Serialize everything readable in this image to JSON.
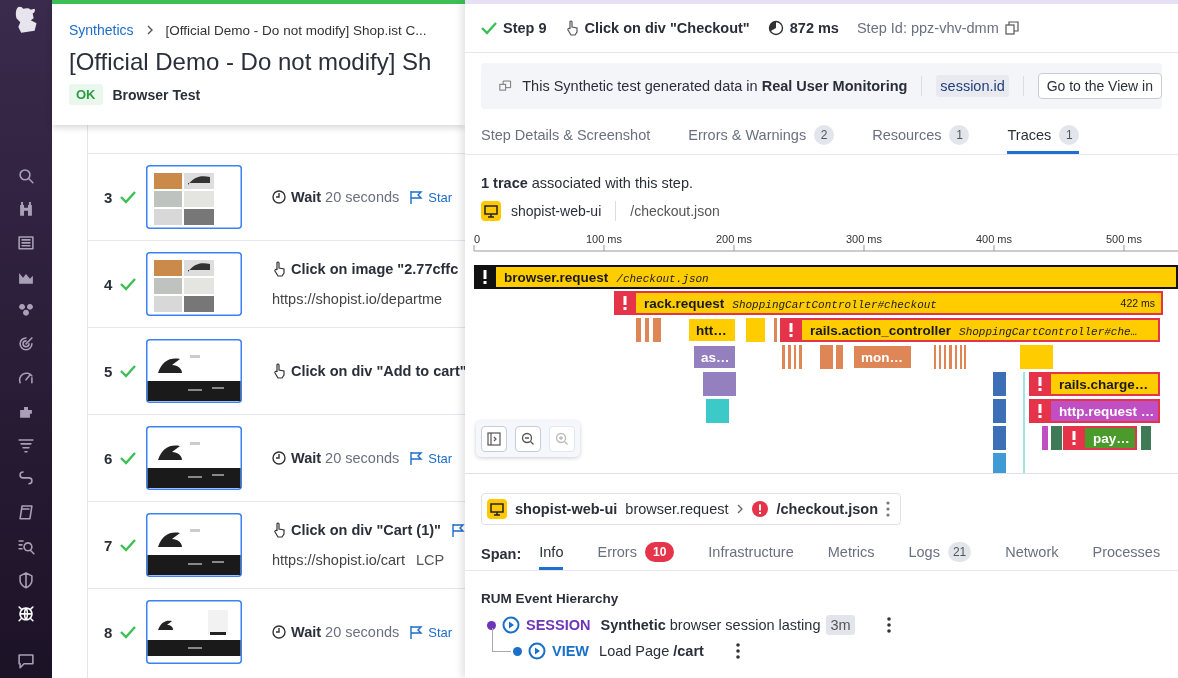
{
  "sidebar": {
    "items": [
      {
        "selected": false
      },
      {
        "selected": false
      },
      {
        "selected": false
      },
      {
        "selected": false
      },
      {
        "selected": false
      },
      {
        "selected": false
      },
      {
        "selected": false
      },
      {
        "selected": false
      },
      {
        "selected": false
      },
      {
        "selected": false
      },
      {
        "selected": false
      },
      {
        "selected": false
      },
      {
        "selected": false
      },
      {
        "selected": true
      },
      {
        "selected": false
      }
    ]
  },
  "test_header": {
    "breadcrumb": [
      "Synthetics",
      "[Official Demo - Do not modify] Shop.ist C..."
    ],
    "title": "[Official Demo - Do not modify] Sh",
    "status": "OK",
    "type": "Browser Test"
  },
  "steps": [
    {
      "number": "3",
      "passed": true,
      "kind": "wait",
      "action": "Wait",
      "detail": "20 seconds",
      "link": "Star"
    },
    {
      "number": "4",
      "passed": true,
      "kind": "click",
      "action": "Click on image \"2.77cffc",
      "url": "https://shopist.io/departme"
    },
    {
      "number": "5",
      "passed": true,
      "kind": "click",
      "action": "Click on div \"Add to cart\""
    },
    {
      "number": "6",
      "passed": true,
      "kind": "wait",
      "action": "Wait",
      "detail": "20 seconds",
      "link": "Star"
    },
    {
      "number": "7",
      "passed": true,
      "kind": "click",
      "action": "Click on div \"Cart (1)\"",
      "flag": true,
      "url": "https://shopist.io/cart",
      "metric": "LCP"
    },
    {
      "number": "8",
      "passed": true,
      "kind": "wait",
      "action": "Wait",
      "detail": "20 seconds",
      "link": "Star"
    }
  ],
  "step_detail": {
    "passed": true,
    "step": "Step 9",
    "action": "Click on div \"Checkout\"",
    "duration": "872 ms",
    "step_id": "Step Id: ppz-vhv-dmm"
  },
  "rum_banner": {
    "text": "This Synthetic test generated data in **Real User Monitoring**",
    "attribute": "session.id",
    "button": "Go to the View in"
  },
  "tabs": [
    {
      "label": "Step Details & Screenshot",
      "selected": false
    },
    {
      "label": "Errors & Warnings",
      "count": "2",
      "selected": false
    },
    {
      "label": "Resources",
      "count": "1",
      "selected": false
    },
    {
      "label": "Traces",
      "count": "1",
      "selected": true
    }
  ],
  "traces": {
    "summary": "**1 trace** associated with this step.",
    "service": "shopist-web-ui",
    "resource": "/checkout.json",
    "axis_ticks": [
      "0",
      "100 ms",
      "200 ms",
      "300 ms",
      "400 ms",
      "500 ms"
    ],
    "spans": [
      {
        "name": "browser.request",
        "resource": "/checkout.json",
        "error": true,
        "color": "#ffcc00"
      },
      {
        "name": "rack.request",
        "resource": "ShoppingCartController#checkout",
        "duration": "422 ms",
        "error": true,
        "color": "#ffcc00"
      },
      {
        "name": "htt…",
        "error": false,
        "color": "#ffcc00"
      },
      {
        "name": "rails.action_controller",
        "resource": "ShoppingCartController#che…",
        "error": true,
        "color": "#ffcc00"
      },
      {
        "name": "as…",
        "error": false,
        "color": "#9580bf"
      },
      {
        "name": "mon…",
        "error": false,
        "color": "#de8656"
      },
      {
        "name": "rails.charge…",
        "error": true,
        "color": "#ffcc00"
      },
      {
        "name": "http.request …",
        "error": true,
        "color": "#c04fc4"
      },
      {
        "name": "pay…",
        "error": true,
        "color": "#4a9a2c"
      }
    ]
  },
  "span_detail": {
    "service": "shopist-web-ui",
    "operation": "browser.request",
    "error": true,
    "resource": "/checkout.json",
    "label": "Span:",
    "tabs": [
      {
        "label": "Info",
        "selected": true
      },
      {
        "label": "Errors",
        "count": "10",
        "alert": true,
        "selected": false
      },
      {
        "label": "Infrastructure",
        "selected": false
      },
      {
        "label": "Metrics",
        "selected": false
      },
      {
        "label": "Logs",
        "count": "21",
        "alert": false,
        "selected": false
      },
      {
        "label": "Network",
        "selected": false
      },
      {
        "label": "Processes",
        "selected": false
      }
    ]
  },
  "rum_hierarchy": {
    "title": "RUM Event Hierarchy",
    "events": [
      {
        "type": "SESSION",
        "color": "#6e35b8",
        "description": "**Synthetic** browser session lasting",
        "duration": "3m",
        "children": [
          {
            "type": "VIEW",
            "color": "#1a6fc8",
            "description": "Load Page **/cart**"
          }
        ]
      }
    ]
  }
}
